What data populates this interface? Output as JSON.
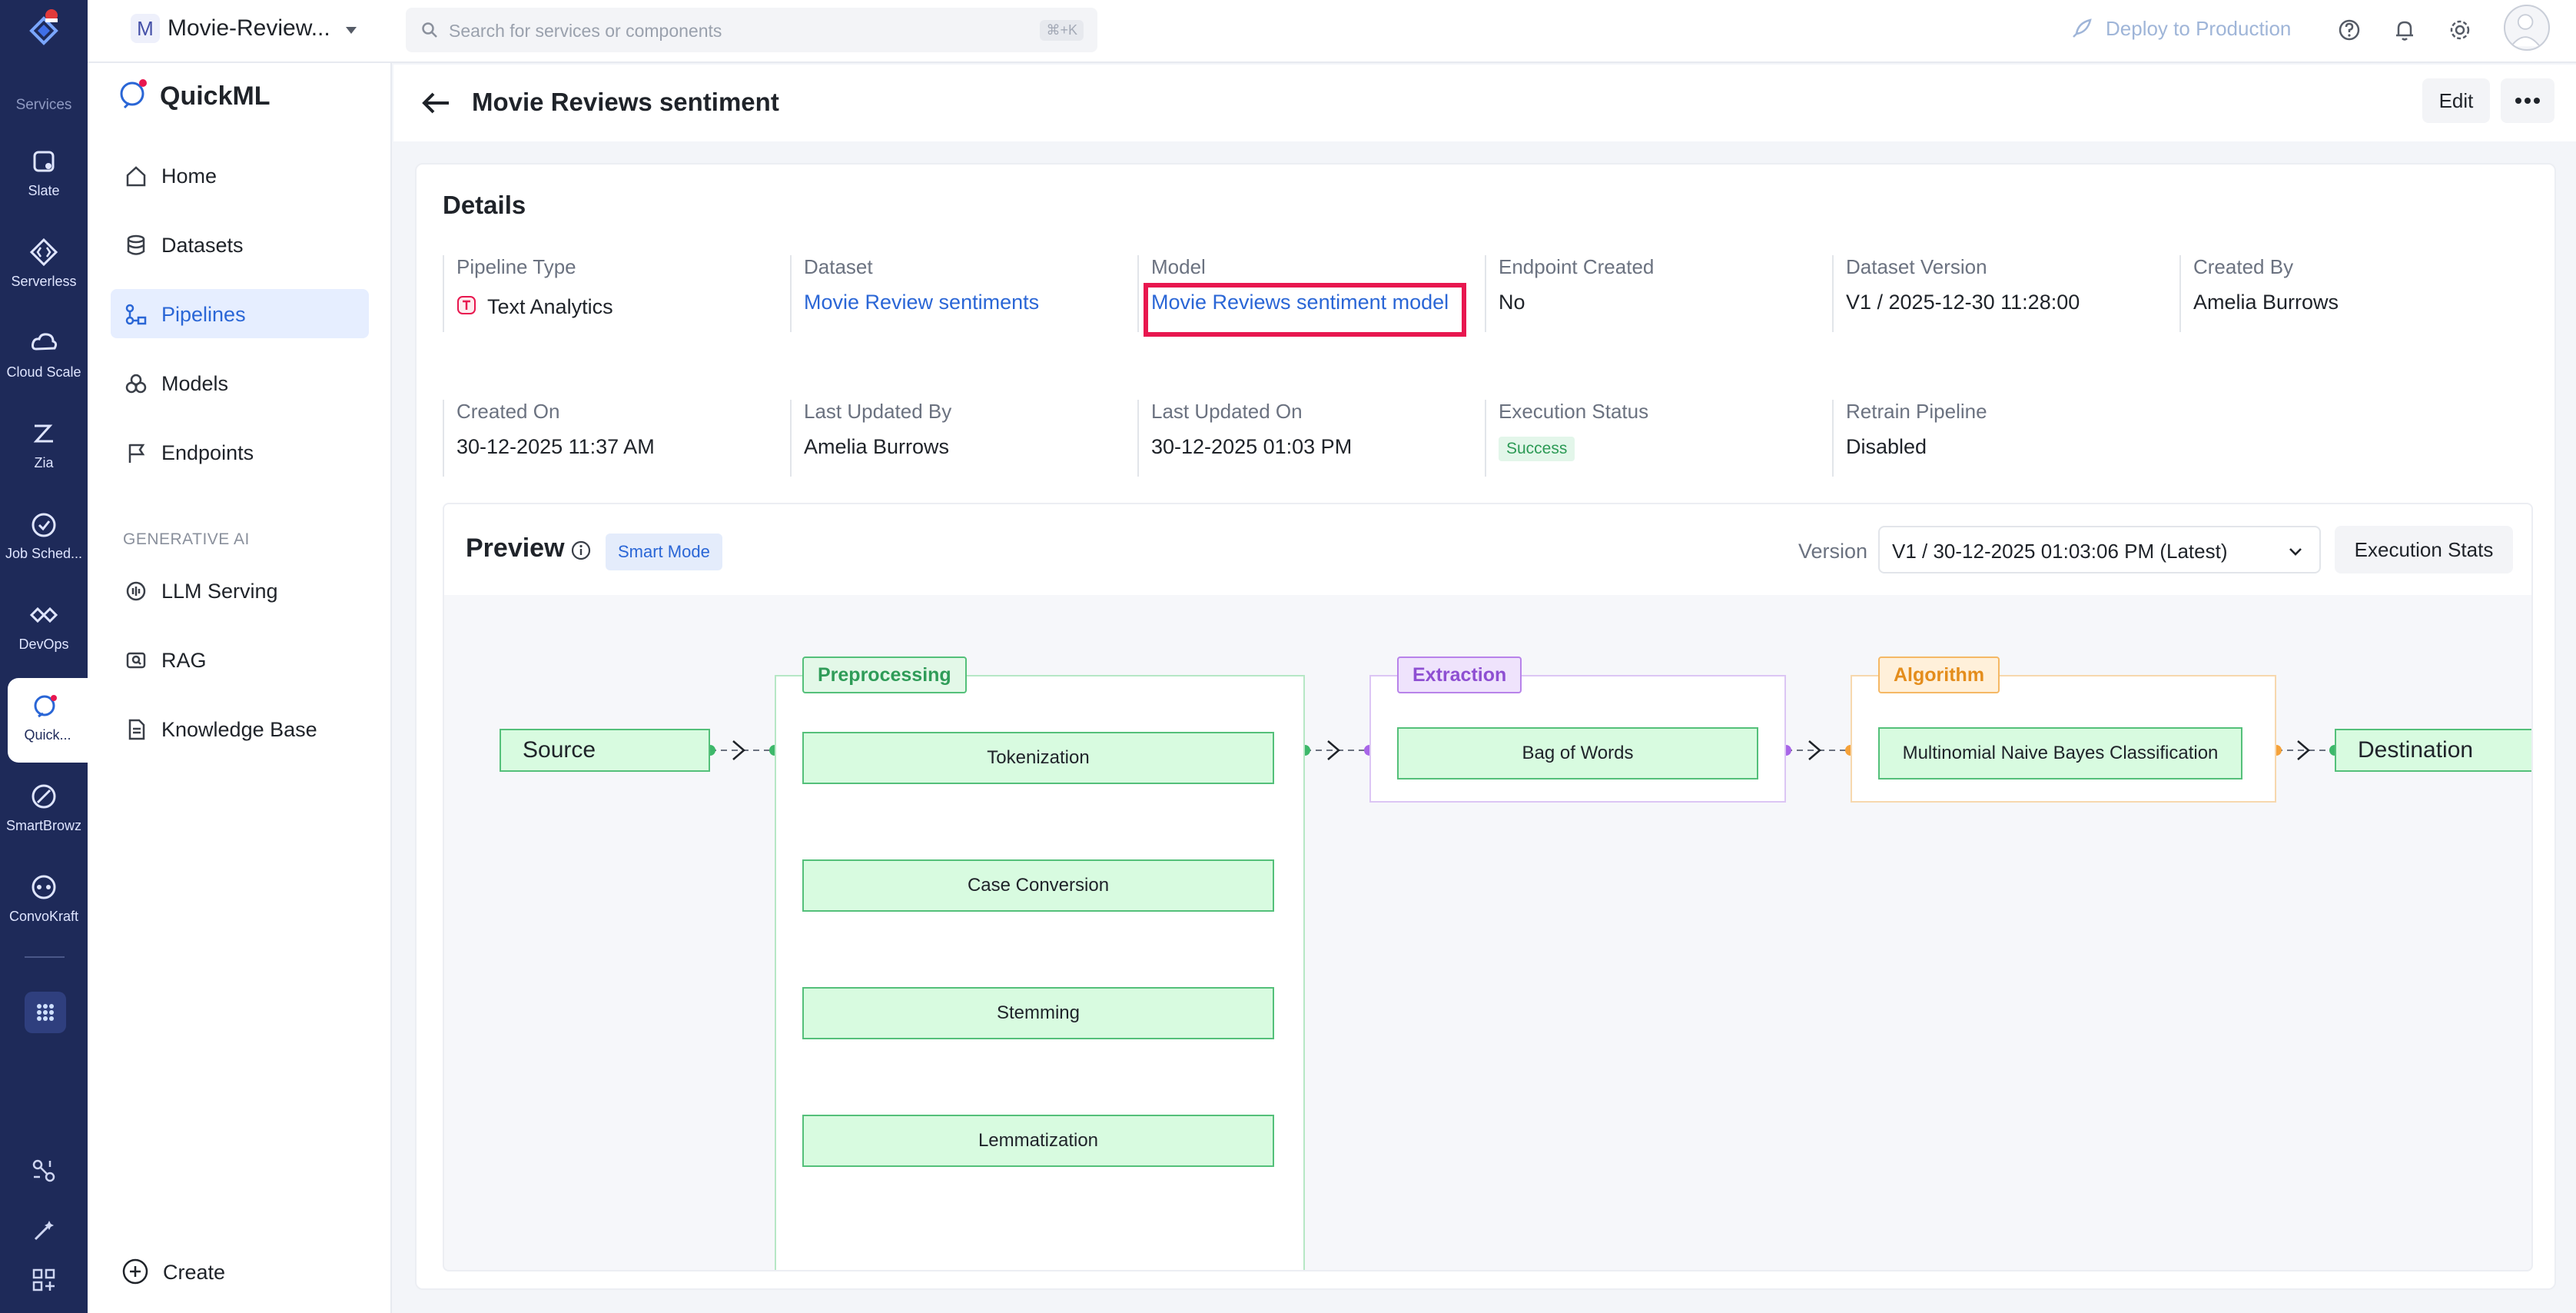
{
  "rail": {
    "services_label": "Services",
    "items": [
      {
        "label": "Slate",
        "icon": "slate-icon"
      },
      {
        "label": "Serverless",
        "icon": "serverless-icon"
      },
      {
        "label": "Cloud Scale",
        "icon": "cloud-scale-icon"
      },
      {
        "label": "Zia",
        "icon": "zia-icon"
      },
      {
        "label": "Job Sched...",
        "icon": "job-scheduling-icon"
      },
      {
        "label": "DevOps",
        "icon": "devops-icon"
      },
      {
        "label": "Quick...",
        "icon": "quickml-icon"
      },
      {
        "label": "SmartBrowz",
        "icon": "smartbrowz-icon"
      },
      {
        "label": "ConvoKraft",
        "icon": "convokraft-icon"
      }
    ]
  },
  "topbar": {
    "project_initial": "M",
    "project_name": "Movie-Review...",
    "search_placeholder": "Search for services or components",
    "search_shortcut": "⌘+K",
    "deploy_label": "Deploy to Production"
  },
  "sidenav": {
    "title": "QuickML",
    "items": [
      {
        "label": "Home"
      },
      {
        "label": "Datasets"
      },
      {
        "label": "Pipelines"
      },
      {
        "label": "Models"
      },
      {
        "label": "Endpoints"
      }
    ],
    "section_label": "GENERATIVE AI",
    "gen_items": [
      {
        "label": "LLM Serving"
      },
      {
        "label": "RAG"
      },
      {
        "label": "Knowledge Base"
      }
    ],
    "create_label": "Create"
  },
  "page": {
    "title": "Movie Reviews sentiment",
    "edit_label": "Edit"
  },
  "details": {
    "title": "Details",
    "fields": {
      "pipeline_type": {
        "label": "Pipeline Type",
        "value": "Text Analytics"
      },
      "dataset": {
        "label": "Dataset",
        "value": "Movie Review sentiments"
      },
      "model": {
        "label": "Model",
        "value": "Movie Reviews sentiment model"
      },
      "endpoint_created": {
        "label": "Endpoint Created",
        "value": "No"
      },
      "dataset_version": {
        "label": "Dataset Version",
        "value": "V1 / 2025-12-30 11:28:00"
      },
      "created_by": {
        "label": "Created By",
        "value": "Amelia Burrows"
      },
      "created_on": {
        "label": "Created On",
        "value": "30-12-2025 11:37 AM"
      },
      "last_updated_by": {
        "label": "Last Updated By",
        "value": "Amelia Burrows"
      },
      "last_updated_on": {
        "label": "Last Updated On",
        "value": "30-12-2025 01:03 PM"
      },
      "execution_status": {
        "label": "Execution Status",
        "value": "Success"
      },
      "retrain_pipeline": {
        "label": "Retrain Pipeline",
        "value": "Disabled"
      }
    }
  },
  "preview": {
    "title": "Preview",
    "mode_badge": "Smart Mode",
    "version_label": "Version",
    "version_value": "V1 / 30-12-2025 01:03:06 PM (Latest)",
    "stats_label": "Execution Stats",
    "flow": {
      "source": "Source",
      "destination": "Destination",
      "preprocessing": {
        "tag": "Preprocessing",
        "steps": [
          "Tokenization",
          "Case Conversion",
          "Stemming",
          "Lemmatization"
        ]
      },
      "extraction": {
        "tag": "Extraction",
        "steps": [
          "Bag of Words"
        ]
      },
      "algorithm": {
        "tag": "Algorithm",
        "steps": [
          "Multinomial Naive Bayes Classification"
        ]
      }
    }
  },
  "colors": {
    "rail_bg": "#1e2a59",
    "accent_blue": "#2a66d6",
    "highlight_red": "#e8174f",
    "node_green": "#54c07a",
    "extraction_purple": "#b883ea",
    "algorithm_orange": "#f5b865"
  }
}
